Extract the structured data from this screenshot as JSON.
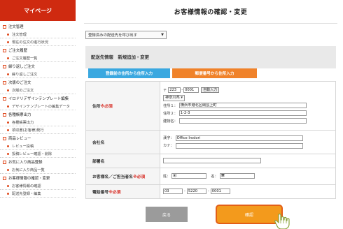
{
  "sidebar": {
    "title": "マイページ",
    "items": [
      {
        "type": "category",
        "label": "注文管理"
      },
      {
        "type": "sub",
        "label": "注文管理"
      },
      {
        "type": "sub",
        "label": "現在の注文の進行状況"
      },
      {
        "type": "category",
        "label": "ご注文履歴"
      },
      {
        "type": "sub",
        "label": "ご注文履歴一覧"
      },
      {
        "type": "category",
        "label": "繰り返しご注文"
      },
      {
        "type": "sub",
        "label": "繰り返しご注文"
      },
      {
        "type": "category",
        "label": "次版のご注文"
      },
      {
        "type": "sub",
        "label": "次版のご注文"
      },
      {
        "type": "category",
        "label": "イロドリデザインテンプレート編集"
      },
      {
        "type": "sub",
        "label": "デザインテンプレートの編集データ"
      },
      {
        "type": "category",
        "label": "各種帳票出力"
      },
      {
        "type": "sub",
        "label": "各種帳票出力"
      },
      {
        "type": "sub",
        "label": "領収書(お客様)発行"
      },
      {
        "type": "category",
        "label": "商品レビュー"
      },
      {
        "type": "sub",
        "label": "レビュー投稿"
      },
      {
        "type": "sub",
        "label": "投稿レビュー確認・削除"
      },
      {
        "type": "category",
        "label": "お気に入り商品登録"
      },
      {
        "type": "sub",
        "label": "お気に入り商品一覧"
      },
      {
        "type": "category",
        "label": "お客様情報の確認・変更"
      },
      {
        "type": "sub",
        "label": "お客様情報の確認"
      },
      {
        "type": "sub",
        "label": "配送先登録・編集"
      }
    ]
  },
  "main": {
    "page_title": "お客様情報の確認・変更",
    "saved_address_select": "登録済みの配送先を呼び出す",
    "section_title": "配送先情報　新規追加・変更",
    "tab_registered": "登録前の住所から住所入力",
    "tab_postal": "郵便番号から住所入力",
    "required_mark": "※必須"
  },
  "form": {
    "address": {
      "label": "住所",
      "postal_prefix": "〒",
      "postal1": "223",
      "postal2": "0001",
      "auto_input_button": "自動入力",
      "prefecture": "神奈川県",
      "line1_label": "住所１：",
      "line1_value": "横浜市港北区綱島上町",
      "line2_label": "住所２：",
      "line2_value": "1-2-3",
      "building_label": "建物名：",
      "building_value": ""
    },
    "company": {
      "label": "会社名",
      "kanji_label": "漢字：",
      "kanji_value": "Office Irodori",
      "kana_label": "カナ：",
      "kana_value": ""
    },
    "department": {
      "label": "部署名",
      "value": ""
    },
    "name": {
      "label": "お客様名／ご担当者名",
      "last_label": "姓：",
      "last_value": "彩",
      "first_label": "名：",
      "first_value": "華"
    },
    "tel": {
      "label": "電話番号",
      "part1": "03",
      "part2": "5220",
      "part3": "0001",
      "separator": "-"
    }
  },
  "buttons": {
    "back": "戻る",
    "confirm": "確認"
  },
  "colors": {
    "sidebar_header": "#cf2a10",
    "tab_blue": "#3aa8e0",
    "tab_orange": "#f0822a",
    "confirm_button": "#f39a1c",
    "required": "#d8322a"
  }
}
